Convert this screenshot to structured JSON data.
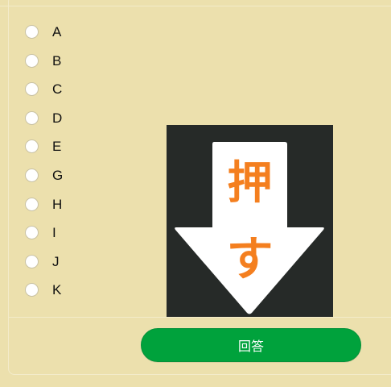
{
  "options": [
    {
      "label": "A"
    },
    {
      "label": "B"
    },
    {
      "label": "C"
    },
    {
      "label": "D"
    },
    {
      "label": "E"
    },
    {
      "label": "G"
    },
    {
      "label": "H"
    },
    {
      "label": "I"
    },
    {
      "label": "J"
    },
    {
      "label": "K"
    }
  ],
  "image": {
    "text_top": "押",
    "text_bottom": "す",
    "colors": {
      "background": "#262a28",
      "arrow": "#ffffff",
      "text": "#f47f1f"
    }
  },
  "answer_button": {
    "label": "回答",
    "color": "#00a23c"
  },
  "theme": {
    "background": "#ece0ad"
  }
}
